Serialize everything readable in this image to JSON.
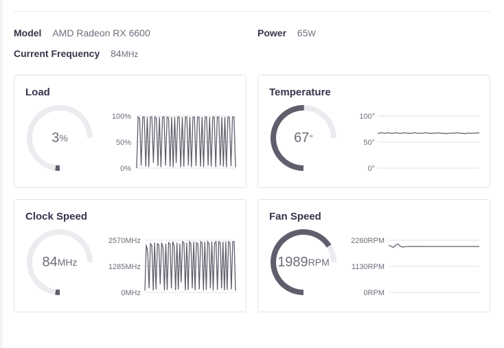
{
  "header": {
    "model_label": "Model",
    "model_value": "AMD Radeon RX 6600",
    "power_label": "Power",
    "power_value": "65",
    "power_unit": "W",
    "freq_label": "Current Frequency",
    "freq_value": "84",
    "freq_unit": "MHz"
  },
  "colors": {
    "accent": "#5f5e6c",
    "track": "#ececf0",
    "border": "#e3e3e8"
  },
  "cards": {
    "load": {
      "title": "Load",
      "value": "3",
      "unit": "%",
      "gauge_fraction": 0.03,
      "ticks": [
        "100%",
        "50%",
        "0%"
      ]
    },
    "temperature": {
      "title": "Temperature",
      "value": "67",
      "unit": "°",
      "gauge_fraction": 0.67,
      "ticks": [
        "100°",
        "50°",
        "0°"
      ]
    },
    "clock": {
      "title": "Clock Speed",
      "value": "84",
      "unit": "MHz",
      "gauge_fraction": 0.03,
      "ticks": [
        "2570MHz",
        "1285MHz",
        "0MHz"
      ]
    },
    "fan": {
      "title": "Fan Speed",
      "value": "1989",
      "unit": "RPM",
      "gauge_fraction": 0.88,
      "ticks": [
        "2260RPM",
        "1130RPM",
        "0RPM"
      ]
    }
  },
  "chart_data": [
    {
      "type": "line",
      "title": "Load",
      "ylim": [
        0,
        100
      ],
      "series": [
        {
          "values": [
            0,
            98,
            95,
            5,
            98,
            98,
            3,
            98,
            2,
            98,
            98,
            10,
            98,
            96,
            4,
            98,
            2,
            98,
            98,
            5,
            98,
            97,
            3,
            98,
            2,
            98,
            10,
            98,
            98,
            2,
            98,
            3,
            98,
            98,
            5,
            98,
            2,
            98,
            98,
            4,
            98,
            98,
            3,
            98,
            2,
            98,
            98,
            5,
            98,
            3,
            98,
            98,
            2,
            98,
            98,
            5,
            98,
            3,
            98,
            2,
            98,
            98,
            4,
            98,
            98,
            2
          ]
        }
      ]
    },
    {
      "type": "line",
      "title": "Temperature",
      "ylim": [
        0,
        100
      ],
      "series": [
        {
          "values": [
            67,
            67,
            68,
            67,
            67,
            68,
            67,
            67,
            67,
            68,
            67,
            67,
            67,
            68,
            67,
            67,
            67,
            67,
            68,
            67,
            67,
            67,
            67,
            68,
            67,
            67,
            67,
            67,
            67,
            68,
            67,
            67,
            67,
            66,
            67,
            67,
            67,
            67,
            68,
            67,
            67,
            67,
            66,
            67,
            67,
            67,
            67,
            67,
            68,
            67
          ]
        }
      ]
    },
    {
      "type": "line",
      "title": "Clock Speed",
      "ylim": [
        0,
        2570
      ],
      "series": [
        {
          "values": [
            84,
            2350,
            2000,
            200,
            2400,
            2300,
            100,
            2450,
            150,
            2400,
            2350,
            400,
            2450,
            2200,
            100,
            2400,
            120,
            2450,
            2400,
            200,
            2500,
            2300,
            100,
            2450,
            150,
            2400,
            500,
            2500,
            2450,
            100,
            2450,
            120,
            2500,
            2400,
            200,
            2500,
            100,
            2450,
            2400,
            150,
            2500,
            2450,
            100,
            2500,
            120,
            2500,
            2400,
            200,
            2500,
            100,
            2450,
            2500,
            120,
            2500,
            2450,
            200,
            2500,
            100,
            2500,
            120,
            2500,
            2450,
            150,
            2500,
            2500,
            84
          ]
        }
      ]
    },
    {
      "type": "line",
      "title": "Fan Speed",
      "ylim": [
        0,
        2260
      ],
      "series": [
        {
          "values": [
            2040,
            2000,
            1950,
            2050,
            2100,
            2000,
            1960,
            1980,
            1990,
            1990,
            1985,
            1990,
            1990,
            1985,
            1990,
            1990,
            1990,
            1988,
            1990,
            1990,
            1990,
            1989,
            1989,
            1990,
            1989,
            1989,
            1989,
            1989,
            1989,
            1989,
            1989,
            1989,
            1989,
            1989,
            1989,
            1989,
            1989,
            1989,
            1989,
            1989
          ]
        }
      ]
    }
  ]
}
